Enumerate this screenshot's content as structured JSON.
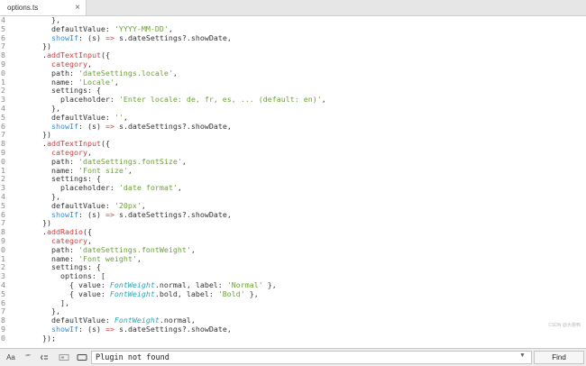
{
  "tab": {
    "title": "options.ts",
    "close_glyph": "×"
  },
  "code_lines": [
    {
      "ln": "4",
      "tokens": [
        {
          "t": "    },",
          "c": "key"
        }
      ]
    },
    {
      "ln": "5",
      "tokens": [
        {
          "t": "    defaultValue: ",
          "c": "key"
        },
        {
          "t": "'YYYY-MM-DD'",
          "c": "str"
        },
        {
          "t": ",",
          "c": "key"
        }
      ]
    },
    {
      "ln": "6",
      "tokens": [
        {
          "t": "    ",
          "c": "key"
        },
        {
          "t": "showIf",
          "c": "prop"
        },
        {
          "t": ": (s) ",
          "c": "key"
        },
        {
          "t": "=>",
          "c": "arrow"
        },
        {
          "t": " s.dateSettings?.showDate,",
          "c": "key"
        }
      ]
    },
    {
      "ln": "7",
      "tokens": [
        {
          "t": "  })",
          "c": "key"
        }
      ]
    },
    {
      "ln": "8",
      "tokens": [
        {
          "t": "  .",
          "c": "key"
        },
        {
          "t": "addTextInput",
          "c": "fn"
        },
        {
          "t": "({",
          "c": "key"
        }
      ]
    },
    {
      "ln": "9",
      "tokens": [
        {
          "t": "    category",
          "c": "fn"
        },
        {
          "t": ",",
          "c": "key"
        }
      ]
    },
    {
      "ln": "0",
      "tokens": [
        {
          "t": "    path: ",
          "c": "key"
        },
        {
          "t": "'dateSettings.locale'",
          "c": "str"
        },
        {
          "t": ",",
          "c": "key"
        }
      ]
    },
    {
      "ln": "1",
      "tokens": [
        {
          "t": "    name: ",
          "c": "key"
        },
        {
          "t": "'Locale'",
          "c": "str"
        },
        {
          "t": ",",
          "c": "key"
        }
      ]
    },
    {
      "ln": "2",
      "tokens": [
        {
          "t": "    settings: {",
          "c": "key"
        }
      ]
    },
    {
      "ln": "3",
      "tokens": [
        {
          "t": "      placeholder: ",
          "c": "key"
        },
        {
          "t": "'Enter locale: de, fr, es, ... (default: en)'",
          "c": "str"
        },
        {
          "t": ",",
          "c": "key"
        }
      ]
    },
    {
      "ln": "4",
      "tokens": [
        {
          "t": "    },",
          "c": "key"
        }
      ]
    },
    {
      "ln": "5",
      "tokens": [
        {
          "t": "    defaultValue: ",
          "c": "key"
        },
        {
          "t": "''",
          "c": "str"
        },
        {
          "t": ",",
          "c": "key"
        }
      ]
    },
    {
      "ln": "6",
      "tokens": [
        {
          "t": "    ",
          "c": "key"
        },
        {
          "t": "showIf",
          "c": "prop"
        },
        {
          "t": ": (s) ",
          "c": "key"
        },
        {
          "t": "=>",
          "c": "arrow"
        },
        {
          "t": " s.dateSettings?.showDate,",
          "c": "key"
        }
      ]
    },
    {
      "ln": "7",
      "tokens": [
        {
          "t": "  })",
          "c": "key"
        }
      ]
    },
    {
      "ln": "8",
      "tokens": [
        {
          "t": "  .",
          "c": "key"
        },
        {
          "t": "addTextInput",
          "c": "fn"
        },
        {
          "t": "({",
          "c": "key"
        }
      ]
    },
    {
      "ln": "9",
      "tokens": [
        {
          "t": "    category",
          "c": "fn"
        },
        {
          "t": ",",
          "c": "key"
        }
      ]
    },
    {
      "ln": "0",
      "tokens": [
        {
          "t": "    path: ",
          "c": "key"
        },
        {
          "t": "'dateSettings.fontSize'",
          "c": "str"
        },
        {
          "t": ",",
          "c": "key"
        }
      ]
    },
    {
      "ln": "1",
      "tokens": [
        {
          "t": "    name: ",
          "c": "key"
        },
        {
          "t": "'Font size'",
          "c": "str"
        },
        {
          "t": ",",
          "c": "key"
        }
      ]
    },
    {
      "ln": "2",
      "tokens": [
        {
          "t": "    settings: {",
          "c": "key"
        }
      ]
    },
    {
      "ln": "3",
      "tokens": [
        {
          "t": "      placeholder: ",
          "c": "key"
        },
        {
          "t": "'date format'",
          "c": "str"
        },
        {
          "t": ",",
          "c": "key"
        }
      ]
    },
    {
      "ln": "4",
      "tokens": [
        {
          "t": "    },",
          "c": "key"
        }
      ]
    },
    {
      "ln": "5",
      "tokens": [
        {
          "t": "    defaultValue: ",
          "c": "key"
        },
        {
          "t": "'20px'",
          "c": "str"
        },
        {
          "t": ",",
          "c": "key"
        }
      ]
    },
    {
      "ln": "6",
      "tokens": [
        {
          "t": "    ",
          "c": "key"
        },
        {
          "t": "showIf",
          "c": "prop"
        },
        {
          "t": ": (s) ",
          "c": "key"
        },
        {
          "t": "=>",
          "c": "arrow"
        },
        {
          "t": " s.dateSettings?.showDate,",
          "c": "key"
        }
      ]
    },
    {
      "ln": "7",
      "tokens": [
        {
          "t": "  })",
          "c": "key"
        }
      ]
    },
    {
      "ln": "8",
      "tokens": [
        {
          "t": "  .",
          "c": "key"
        },
        {
          "t": "addRadio",
          "c": "fn"
        },
        {
          "t": "({",
          "c": "key"
        }
      ]
    },
    {
      "ln": "9",
      "tokens": [
        {
          "t": "    category",
          "c": "fn"
        },
        {
          "t": ",",
          "c": "key"
        }
      ]
    },
    {
      "ln": "0",
      "tokens": [
        {
          "t": "    path: ",
          "c": "key"
        },
        {
          "t": "'dateSettings.fontWeight'",
          "c": "str"
        },
        {
          "t": ",",
          "c": "key"
        }
      ]
    },
    {
      "ln": "1",
      "tokens": [
        {
          "t": "    name: ",
          "c": "key"
        },
        {
          "t": "'Font weight'",
          "c": "str"
        },
        {
          "t": ",",
          "c": "key"
        }
      ]
    },
    {
      "ln": "2",
      "tokens": [
        {
          "t": "    settings: {",
          "c": "key"
        }
      ]
    },
    {
      "ln": "3",
      "tokens": [
        {
          "t": "      options: [",
          "c": "key"
        }
      ]
    },
    {
      "ln": "4",
      "tokens": [
        {
          "t": "        { value: ",
          "c": "key"
        },
        {
          "t": "FontWeight",
          "c": "type"
        },
        {
          "t": ".normal, label: ",
          "c": "key"
        },
        {
          "t": "'Normal'",
          "c": "str"
        },
        {
          "t": " },",
          "c": "key"
        }
      ]
    },
    {
      "ln": "5",
      "tokens": [
        {
          "t": "        { value: ",
          "c": "key"
        },
        {
          "t": "FontWeight",
          "c": "type"
        },
        {
          "t": ".bold, label: ",
          "c": "key"
        },
        {
          "t": "'Bold'",
          "c": "str"
        },
        {
          "t": " },",
          "c": "key"
        }
      ]
    },
    {
      "ln": "6",
      "tokens": [
        {
          "t": "      ],",
          "c": "key"
        }
      ]
    },
    {
      "ln": "7",
      "tokens": [
        {
          "t": "    },",
          "c": "key"
        }
      ]
    },
    {
      "ln": "8",
      "tokens": [
        {
          "t": "    defaultValue: ",
          "c": "key"
        },
        {
          "t": "FontWeight",
          "c": "type"
        },
        {
          "t": ".normal,",
          "c": "key"
        }
      ]
    },
    {
      "ln": "9",
      "tokens": [
        {
          "t": "    ",
          "c": "key"
        },
        {
          "t": "showIf",
          "c": "prop"
        },
        {
          "t": ": (s) ",
          "c": "key"
        },
        {
          "t": "=>",
          "c": "arrow"
        },
        {
          "t": " s.dateSettings?.showDate,",
          "c": "key"
        }
      ]
    },
    {
      "ln": "0",
      "tokens": [
        {
          "t": "  });",
          "c": "key"
        }
      ]
    }
  ],
  "watermark": "CSDN @大桃鸭",
  "findbar": {
    "case_label": "Aa",
    "word_label": "“”",
    "regex_icon": "regex-icon",
    "selection_icon": "in-selection-icon",
    "wrap_icon": "wrap-icon",
    "query": "Plugin not found",
    "dropdown_glyph": "▼",
    "find_label": "Find"
  },
  "colors": {
    "string": "#6aa431",
    "function": "#d43b3b",
    "property": "#3a8bd1",
    "type": "#2aa5b3"
  }
}
